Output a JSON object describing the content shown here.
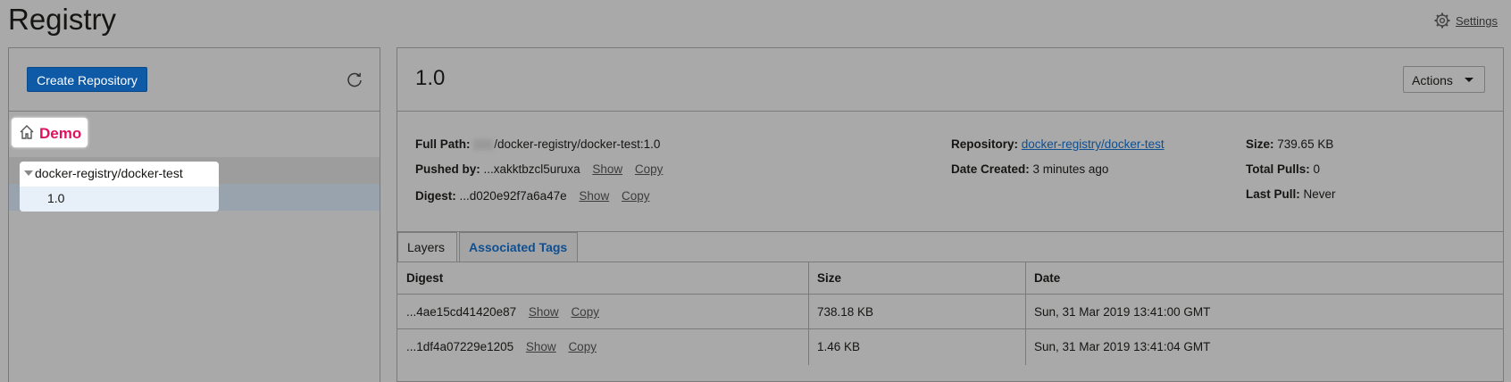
{
  "page": {
    "title": "Registry",
    "settings_label": "Settings"
  },
  "left": {
    "create_button": "Create Repository",
    "compartment": "Demo",
    "tree": {
      "repository": "docker-registry/docker-test",
      "tag": "1.0"
    }
  },
  "detail": {
    "title": "1.0",
    "actions_label": "Actions",
    "full_path_label": "Full Path:",
    "full_path_value": "/docker-registry/docker-test:1.0",
    "pushed_by_label": "Pushed by:",
    "pushed_by_value": "...xakktbzcl5uruxa",
    "digest_label": "Digest:",
    "digest_value": "...d020e92f7a6a47e",
    "show": "Show",
    "copy": "Copy",
    "repository_label": "Repository:",
    "repository_value": "docker-registry/docker-test",
    "date_created_label": "Date Created:",
    "date_created_value": "3 minutes ago",
    "size_label": "Size:",
    "size_value": "739.65 KB",
    "total_pulls_label": "Total Pulls:",
    "total_pulls_value": "0",
    "last_pull_label": "Last Pull:",
    "last_pull_value": "Never"
  },
  "tabs": [
    "Layers",
    "Associated Tags"
  ],
  "layers": {
    "columns": [
      "Digest",
      "Size",
      "Date"
    ],
    "rows": [
      {
        "digest": "...4ae15cd41420e87",
        "size": "738.18 KB",
        "date": "Sun, 31 Mar 2019 13:41:00 GMT"
      },
      {
        "digest": "...1df4a07229e1205",
        "size": "1.46 KB",
        "date": "Sun, 31 Mar 2019 13:41:04 GMT"
      }
    ]
  },
  "colors": {
    "primary_button": "#0e5aa7",
    "link": "#0e4f92",
    "demo_label": "#e0115f"
  },
  "icons": [
    "gear-icon",
    "refresh-icon",
    "home-icon",
    "caret-down-icon"
  ]
}
